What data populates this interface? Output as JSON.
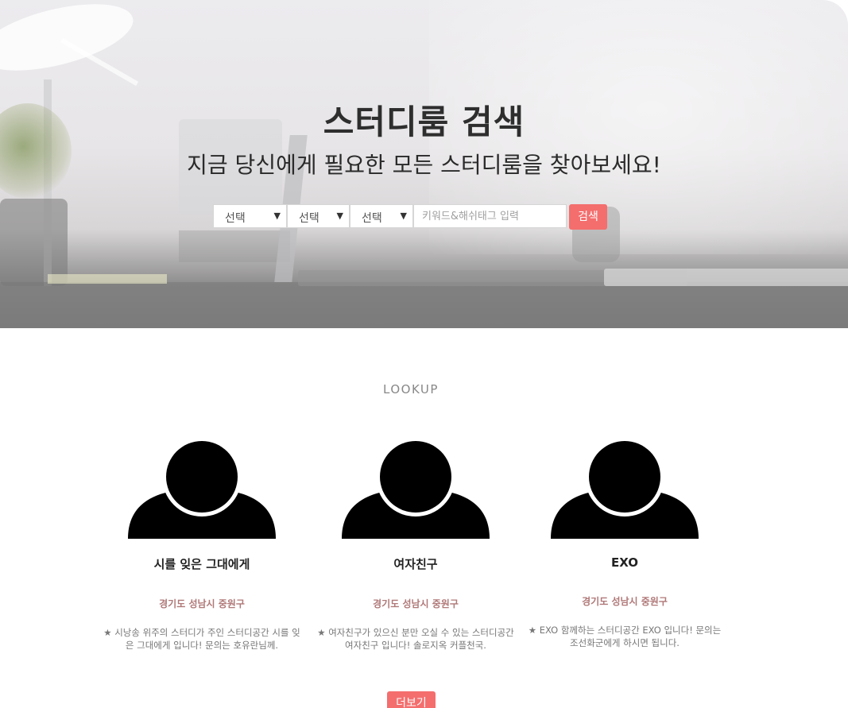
{
  "hero": {
    "title": "스터디룸 검색",
    "subtitle": "지금 당신에게 필요한 모든 스터디룸을 찾아보세요!",
    "selects": [
      {
        "value": "선택"
      },
      {
        "value": "선택"
      },
      {
        "value": "선택"
      }
    ],
    "keyword_placeholder": "키워드&해쉬태그 입력",
    "search_label": "검색"
  },
  "lookup": {
    "label": "LOOKUP",
    "cards": [
      {
        "name": "시를 잊은 그대에게",
        "location": "경기도 성남시 중원구",
        "desc": "★ 시낭송 위주의 스터디가 주인 스터디공간 시를 잊은 그대에게 입니다! 문의는 호유란님께."
      },
      {
        "name": "여자친구",
        "location": "경기도 성남시 중원구",
        "desc": "★ 여자친구가 있으신 분만 오실 수 있는 스터디공간 여자친구 입니다! 솔로지옥 커플천국."
      },
      {
        "name": "EXO",
        "location": "경기도 성남시 중원구",
        "desc": "★ EXO 함께하는 스터디공간 EXO 입니다! 문의는 조선화군에게 하시면 됩니다."
      }
    ],
    "more_label": "더보기"
  },
  "colors": {
    "accent": "#f46e6e",
    "location": "#b07878"
  },
  "icons": {
    "avatar": "user-silhouette-icon",
    "dropdown": "caret-down-icon"
  }
}
